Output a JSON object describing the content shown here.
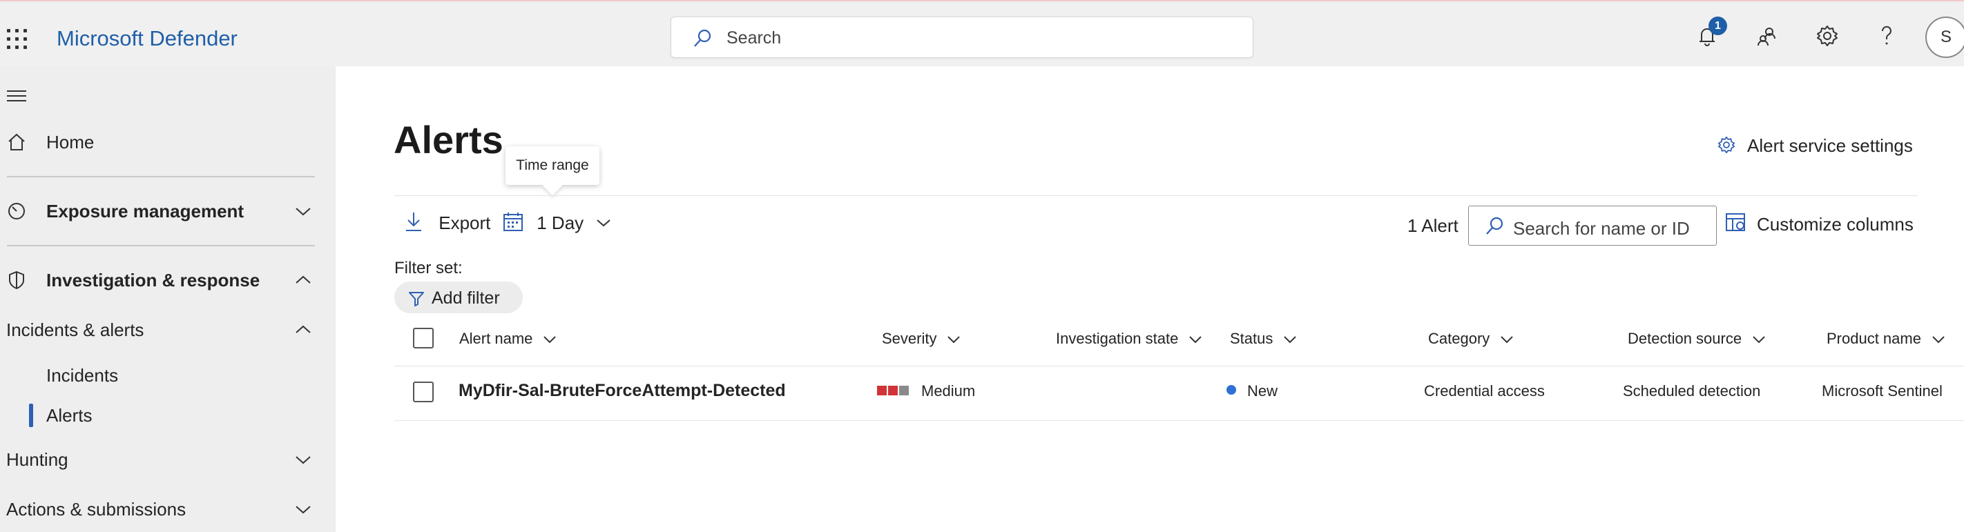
{
  "app": {
    "title": "Microsoft Defender"
  },
  "search": {
    "placeholder": "Search"
  },
  "notifications": {
    "count": "1"
  },
  "user": {
    "initial": "S"
  },
  "sidebar": {
    "items": [
      {
        "label": "Home"
      },
      {
        "label": "Exposure management"
      },
      {
        "label": "Investigation & response"
      },
      {
        "label": "Incidents & alerts"
      },
      {
        "label": "Incidents"
      },
      {
        "label": "Alerts"
      },
      {
        "label": "Hunting"
      },
      {
        "label": "Actions & submissions"
      }
    ]
  },
  "page": {
    "title": "Alerts",
    "tooltip": "Time range",
    "service_settings": "Alert service settings"
  },
  "toolbar": {
    "export": "Export",
    "time_range": "1 Day",
    "alert_count": "1 Alert",
    "find_placeholder": "Search for name or ID",
    "customize": "Customize columns"
  },
  "filters": {
    "label": "Filter set:",
    "add": "Add filter"
  },
  "table": {
    "columns": [
      "Alert name",
      "Severity",
      "Investigation state",
      "Status",
      "Category",
      "Detection source",
      "Product name"
    ],
    "rows": [
      {
        "name": "MyDfir-Sal-BruteForceAttempt-Detected",
        "severity": "Medium",
        "investigation_state": "",
        "status": "New",
        "category": "Credential access",
        "detection_source": "Scheduled detection",
        "product": "Microsoft Sentinel"
      }
    ]
  },
  "colors": {
    "brand": "#1f5fa8",
    "severity_high": "#d13438",
    "severity_off": "#8a8a8a",
    "status_new": "#2f6fd6",
    "active_nav": "#2f5fb3"
  }
}
